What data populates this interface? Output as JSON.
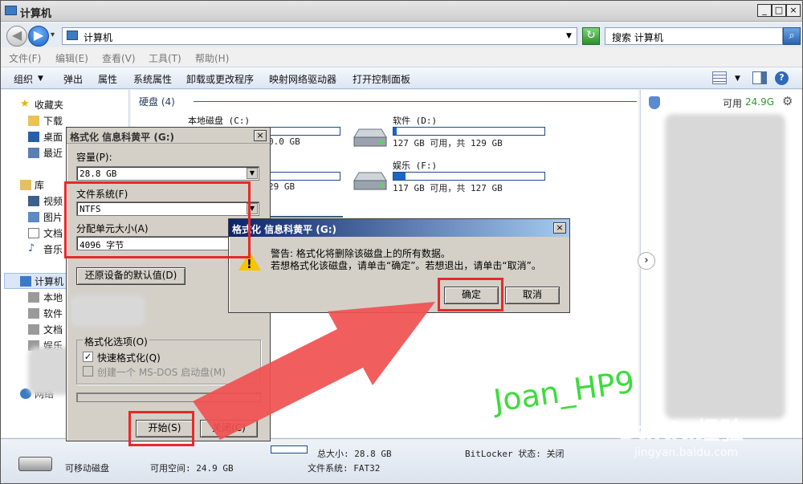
{
  "window": {
    "title": "计算机",
    "controls": [
      "_",
      "□",
      "×"
    ]
  },
  "address": {
    "path": "计算机",
    "search_placeholder": "搜索 计算机"
  },
  "menu": [
    "文件(F)",
    "编辑(E)",
    "查看(V)",
    "工具(T)",
    "帮助(H)"
  ],
  "toolbar": [
    "组织",
    "弹出",
    "属性",
    "系统属性",
    "卸载或更改程序",
    "映射网络驱动器",
    "打开控制面板"
  ],
  "nav": {
    "favorites": "收藏夹",
    "downloads": "下载",
    "desktop": "桌面",
    "recent": "最近",
    "library": "库",
    "videos": "视频",
    "pictures": "图片",
    "docs": "文档",
    "music": "音乐",
    "computer": "计算机",
    "local": "本地",
    "soft": "软件",
    "docs2": "文档",
    "ent": "娱乐",
    "network": "网络"
  },
  "content": {
    "group": "硬盘 (4)",
    "drives": [
      {
        "name": "本地磁盘 (C:)",
        "info": "0.0 GB",
        "fill": 0.3
      },
      {
        "name": "软件 (D:)",
        "info": "127 GB 可用，共 129 GB",
        "fill": 0.02
      },
      {
        "name": "",
        "info": "29 GB",
        "fill": 0.1
      },
      {
        "name": "娱乐 (F:)",
        "info": "117 GB 可用，共 127 GB",
        "fill": 0.08
      }
    ]
  },
  "rightpane": {
    "free_label": "可用",
    "free_value": "24.9G"
  },
  "status": {
    "device": "可移动磁盘",
    "free": "可用空间: 24.9 GB",
    "total": "总大小: 28.8 GB",
    "fs": "文件系统: FAT32",
    "bitlocker": "BitLocker 状态: 关闭"
  },
  "format_dialog": {
    "title": "格式化 信息科黄平 (G:)",
    "capacity_label": "容量(P):",
    "capacity_value": "28.8 GB",
    "fs_label": "文件系统(F)",
    "fs_value": "NTFS",
    "alloc_label": "分配单元大小(A)",
    "alloc_value": "4096 字节",
    "restore_btn": "还原设备的默认值(D)",
    "options_label": "格式化选项(O)",
    "quick_format": "快速格式化(Q)",
    "msdos": "创建一个 MS-DOS 启动盘(M)",
    "start_btn": "开始(S)",
    "close_btn": "关闭(C)"
  },
  "warn_dialog": {
    "title": "格式化 信息科黄平 (G:)",
    "line1": "警告: 格式化将删除该磁盘上的所有数据。",
    "line2": "若想格式化该磁盘，请单击“确定”。若想退出，请单击“取消”。",
    "ok": "确定",
    "cancel": "取消"
  },
  "watermark": {
    "author": "Joan_HP9",
    "brand": "Baidu经验",
    "url": "jingyan.baidu.com"
  },
  "colors": {
    "red_annotation": "#e8282a",
    "arrow": "#f05050",
    "watermark_green": "#3ddc3d"
  }
}
